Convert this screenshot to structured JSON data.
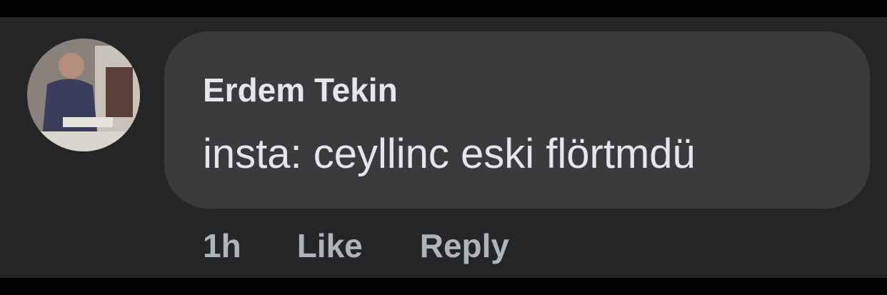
{
  "comment": {
    "avatar_icon": "user-avatar-photo",
    "author": "Erdem Tekin",
    "text": "insta: ceyllinc eski flörtmdü",
    "timestamp": "1h",
    "like_label": "Like",
    "reply_label": "Reply"
  },
  "colors": {
    "background": "#242526",
    "bubble": "#3a3b3c",
    "primary_text": "#e4e6eb",
    "secondary_text": "#b0b3b8"
  }
}
